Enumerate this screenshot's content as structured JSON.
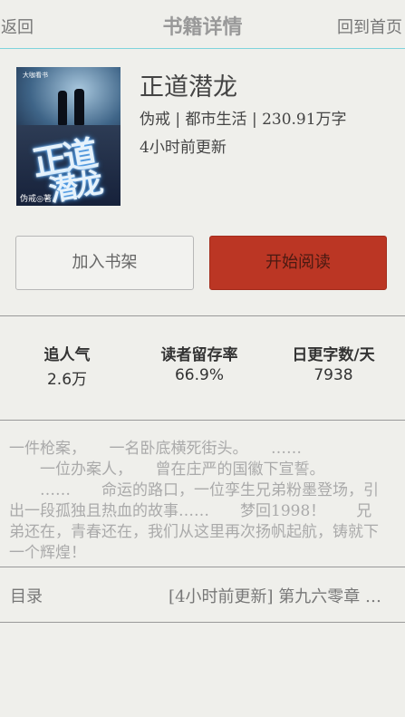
{
  "topbar": {
    "back_label": "返回",
    "title": "书籍详情",
    "home_label": "回到首页"
  },
  "book": {
    "title": "正道潜龙",
    "meta": "伪戒 | 都市生活 | 230.91万字",
    "update": "4小时前更新",
    "cover": {
      "tag": "大咖看书",
      "calligraphy_line1": "正道",
      "calligraphy_line2": "潜龙",
      "author": "伪戒◎著"
    }
  },
  "actions": {
    "add_shelf_label": "加入书架",
    "start_reading_label": "开始阅读"
  },
  "stats": [
    {
      "label": "追人气",
      "value": "2.6万"
    },
    {
      "label": "读者留存率",
      "value": "66.9%"
    },
    {
      "label": "日更字数/天",
      "value": "7938"
    }
  ],
  "description": "一件枪案，　　一名卧底横死街头。　　……\n　　一位办案人，　　曾在庄严的国徽下宣誓。\n　　……　　命运的路口，一位孪生兄弟粉墨登场，引出一段孤独且热血的故事……　　梦回1998！　　兄弟还在，青春还在，我们从这里再次扬帆起航，铸就下一个辉煌！",
  "toc": {
    "label": "目录",
    "latest": "[4小时前更新] 第九六零章 …"
  },
  "colors": {
    "background": "#efefeb",
    "accent_red": "#bb3624",
    "topbar_border": "#7fd4dc"
  }
}
